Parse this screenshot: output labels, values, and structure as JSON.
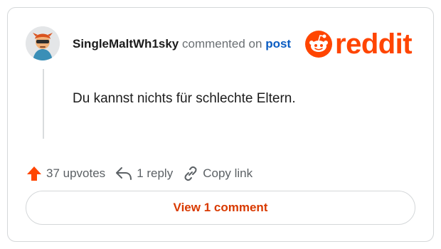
{
  "comment": {
    "username": "SingleMaltWh1sky",
    "action_text": "commented on",
    "post_link_text": "post",
    "body": "Du kannst nichts für schlechte Eltern."
  },
  "brand": {
    "name": "reddit",
    "color": "#ff4500"
  },
  "actions": {
    "upvotes_label": "37 upvotes",
    "reply_label": "1 reply",
    "copy_label": "Copy link",
    "upvote_icon": "upvote-arrow-icon",
    "reply_icon": "reply-arrow-icon",
    "copy_icon": "link-chain-icon"
  },
  "footer": {
    "view_button_label": "View 1 comment"
  },
  "colors": {
    "accent": "#ff4500",
    "link": "#0a5cc2",
    "button_text": "#d93a00"
  }
}
